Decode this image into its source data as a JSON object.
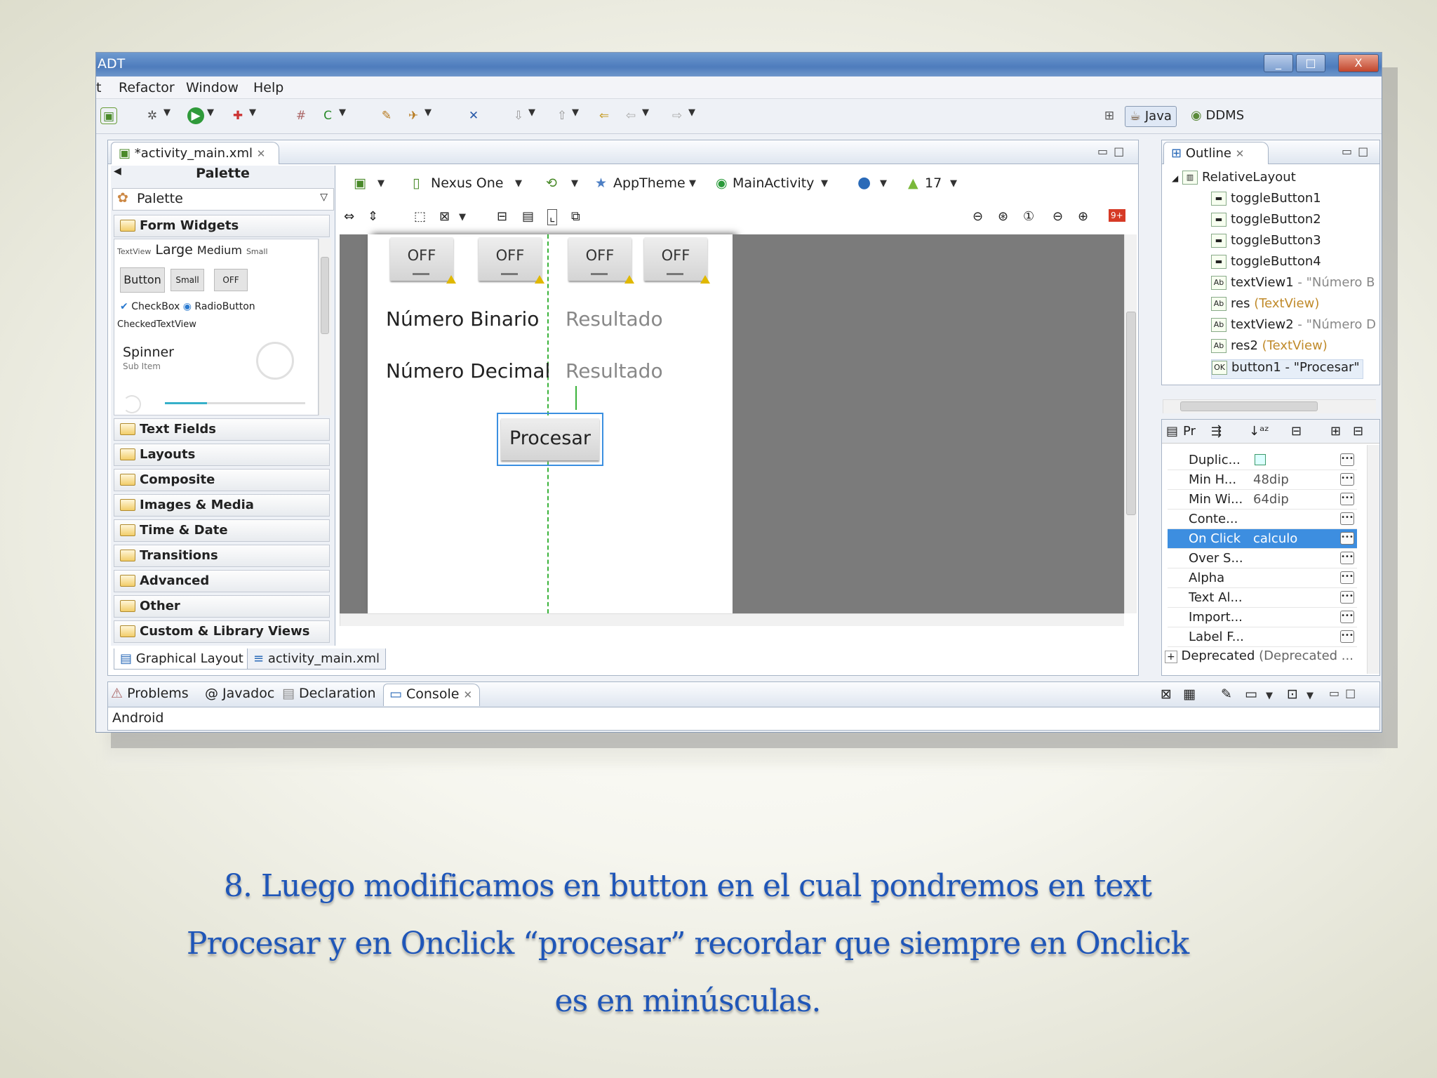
{
  "window": {
    "title": "ADT",
    "controls": [
      "_",
      "□",
      "X"
    ]
  },
  "menu": [
    "t",
    "Refactor",
    "Window",
    "Help"
  ],
  "perspectives": {
    "java": "Java",
    "ddms": "DDMS"
  },
  "editor": {
    "file_tab": "*activity_main.xml",
    "palette": {
      "header": "Palette",
      "dropdown": "Palette",
      "form_widgets": "Form Widgets",
      "textview_row": {
        "small_label": "TextView",
        "large": "Large",
        "medium": "Medium",
        "small": "Small"
      },
      "buttons": {
        "button": "Button",
        "small": "Small",
        "off": "OFF"
      },
      "checkbox": "CheckBox",
      "radio": "RadioButton",
      "checked_textview": "CheckedTextView",
      "spinner": "Spinner",
      "spinner_sub": "Sub Item",
      "categories": [
        "Text Fields",
        "Layouts",
        "Composite",
        "Images & Media",
        "Time & Date",
        "Transitions",
        "Advanced",
        "Other",
        "Custom & Library Views"
      ]
    },
    "canvas_toolbar": {
      "device": "Nexus One",
      "theme": "AppTheme",
      "activity": "MainActivity",
      "api": "17",
      "badge": "9+"
    },
    "canvas": {
      "toggles": [
        "OFF",
        "OFF",
        "OFF",
        "OFF"
      ],
      "label_binario": "Número Binario",
      "result1": "Resultado",
      "label_decimal": "Número Decimal",
      "result2": "Resultado",
      "button": "Procesar"
    },
    "bottom_tabs": {
      "graphical": "Graphical Layout",
      "xml": "activity_main.xml"
    }
  },
  "outline": {
    "tab": "Outline",
    "root": "RelativeLayout",
    "items": [
      {
        "name": "toggleButton1",
        "extra": ""
      },
      {
        "name": "toggleButton2",
        "extra": ""
      },
      {
        "name": "toggleButton3",
        "extra": ""
      },
      {
        "name": "toggleButton4",
        "extra": ""
      },
      {
        "name": "textView1",
        "extra": " - \"Número B"
      },
      {
        "name": "res",
        "extra": " (TextView)"
      },
      {
        "name": "textView2",
        "extra": " - \"Número D"
      },
      {
        "name": "res2",
        "extra": " (TextView)"
      },
      {
        "name": "button1",
        "extra": " - \"Procesar\""
      }
    ]
  },
  "properties": {
    "tab_label": "Pr",
    "rows": [
      {
        "key": "Duplic...",
        "value": ""
      },
      {
        "key": "Min H...",
        "value": "48dip"
      },
      {
        "key": "Min Wi...",
        "value": "64dip"
      },
      {
        "key": "Conte...",
        "value": ""
      },
      {
        "key": "On Click",
        "value": "calculo"
      },
      {
        "key": "Over S...",
        "value": ""
      },
      {
        "key": "Alpha",
        "value": ""
      },
      {
        "key": "Text Al...",
        "value": ""
      },
      {
        "key": "Import...",
        "value": ""
      },
      {
        "key": "Label F...",
        "value": ""
      }
    ],
    "deprecated": {
      "key": "Deprecated",
      "value": "(Deprecated ..."
    }
  },
  "console": {
    "tabs": [
      "Problems",
      "Javadoc",
      "Declaration",
      "Console"
    ],
    "content": "Android"
  },
  "caption": {
    "line1": "8. Luego modificamos en button en el cual pondremos en text",
    "line2": "Procesar y en Onclick “procesar” recordar que siempre en Onclick",
    "line3": "es en minúsculas."
  }
}
